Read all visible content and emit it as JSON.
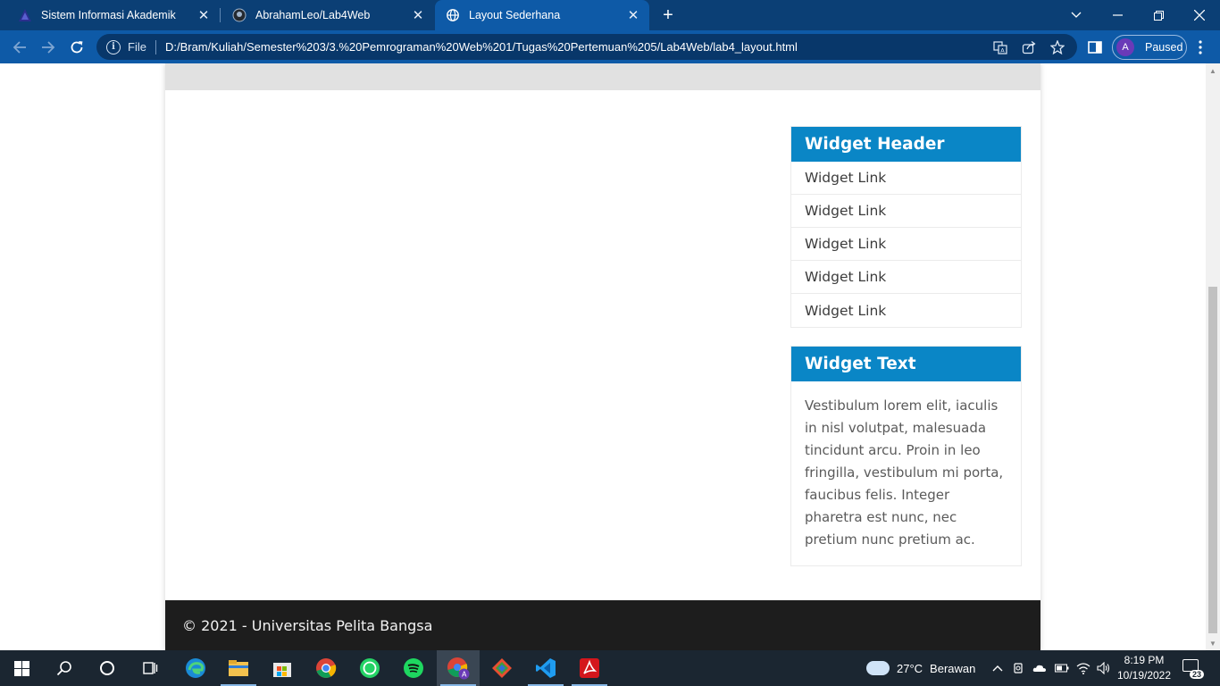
{
  "browser": {
    "tabs": [
      {
        "title": "Sistem Informasi Akademik",
        "favicon": "academic-logo-icon",
        "active": false
      },
      {
        "title": "AbrahamLeo/Lab4Web",
        "favicon": "github-icon",
        "active": false
      },
      {
        "title": "Layout Sederhana",
        "favicon": "globe-icon",
        "active": true
      }
    ],
    "new_tab_label": "+",
    "omnibox": {
      "scheme_label": "File",
      "url": "D:/Bram/Kuliah/Semester%203/3.%20Pemrograman%20Web%201/Tugas%20Pertemuan%205/Lab4Web/lab4_layout.html"
    },
    "profile": {
      "initial": "A",
      "status": "Paused"
    },
    "colors": {
      "tabbar": "#0b3f75",
      "toolbar": "#0e5aa7",
      "omnibox": "#08376a"
    }
  },
  "page": {
    "widgets": [
      {
        "header": "Widget Header",
        "links": [
          "Widget Link",
          "Widget Link",
          "Widget Link",
          "Widget Link",
          "Widget Link"
        ]
      },
      {
        "header": "Widget Text",
        "body": "Vestibulum lorem elit, iaculis in nisl volutpat, malesuada tincidunt arcu. Proin in leo fringilla, vestibulum mi porta, faucibus felis. Integer pharetra est nunc, nec pretium nunc pretium ac."
      }
    ],
    "footer": "© 2021 - Universitas Pelita Bangsa",
    "colors": {
      "widget_header": "#0a86c6",
      "footer_bg": "#1d1d1d",
      "header_strip": "#e1e1e1"
    }
  },
  "taskbar": {
    "apps": [
      "start-icon",
      "search-icon",
      "cortana-icon",
      "task-view-icon",
      "edge-icon",
      "file-explorer-icon",
      "store-icon",
      "chrome-icon",
      "whatsapp-icon",
      "spotify-icon",
      "chrome-profile-icon",
      "git-icon",
      "vscode-icon",
      "acrobat-icon"
    ],
    "weather": {
      "temperature": "27°C",
      "condition": "Berawan"
    },
    "time": "8:19 PM",
    "date": "10/19/2022",
    "notification_count": "23"
  }
}
